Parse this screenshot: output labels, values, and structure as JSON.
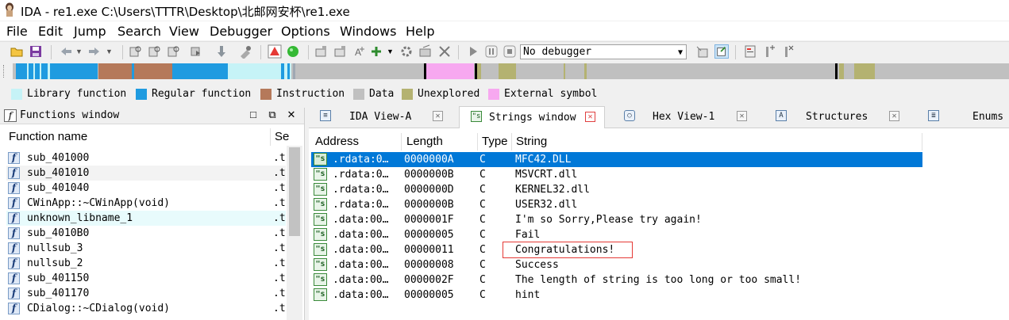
{
  "window": {
    "title": "IDA - re1.exe C:\\Users\\TTTR\\Desktop\\北邮网安杯\\re1.exe"
  },
  "menu": [
    "File",
    "Edit",
    "Jump",
    "Search",
    "View",
    "Debugger",
    "Options",
    "Windows",
    "Help"
  ],
  "toolbar": {
    "debugger_select": "No debugger"
  },
  "legend": [
    {
      "label": "Library function",
      "color": "#c6f3f7"
    },
    {
      "label": "Regular function",
      "color": "#1f9be0"
    },
    {
      "label": "Instruction",
      "color": "#b5795a"
    },
    {
      "label": "Data",
      "color": "#c0c0c0"
    },
    {
      "label": "Unexplored",
      "color": "#b4b271"
    },
    {
      "label": "External symbol",
      "color": "#f7a8f0"
    }
  ],
  "functions_window": {
    "title": "Functions window",
    "col_name": "Function name",
    "col_segment": "Se",
    "rows": [
      {
        "name": "sub_401000",
        "seg": ".t"
      },
      {
        "name": "sub_401010",
        "seg": ".t"
      },
      {
        "name": "sub_401040",
        "seg": ".t"
      },
      {
        "name": "CWinApp::~CWinApp(void)",
        "seg": ".t"
      },
      {
        "name": "unknown_libname_1",
        "seg": ".t"
      },
      {
        "name": "sub_4010B0",
        "seg": ".t"
      },
      {
        "name": "nullsub_3",
        "seg": ".t"
      },
      {
        "name": "nullsub_2",
        "seg": ".t"
      },
      {
        "name": "sub_401150",
        "seg": ".t"
      },
      {
        "name": "sub_401170",
        "seg": ".t"
      },
      {
        "name": "CDialog::~CDialog(void)",
        "seg": ".t"
      }
    ]
  },
  "tabs": [
    {
      "label": "IDA View-A"
    },
    {
      "label": "Strings window"
    },
    {
      "label": "Hex View-1"
    },
    {
      "label": "Structures"
    },
    {
      "label": "Enums"
    }
  ],
  "strings_window": {
    "columns": [
      "Address",
      "Length",
      "Type",
      "String"
    ],
    "rows": [
      {
        "address": ".rdata:0…",
        "length": "0000000A",
        "type": "C",
        "string": "MFC42.DLL"
      },
      {
        "address": ".rdata:0…",
        "length": "0000000B",
        "type": "C",
        "string": "MSVCRT.dll"
      },
      {
        "address": ".rdata:0…",
        "length": "0000000D",
        "type": "C",
        "string": "KERNEL32.dll"
      },
      {
        "address": ".rdata:0…",
        "length": "0000000B",
        "type": "C",
        "string": "USER32.dll"
      },
      {
        "address": ".data:00…",
        "length": "0000001F",
        "type": "C",
        "string": "I'm so Sorry,Please try again!"
      },
      {
        "address": ".data:00…",
        "length": "00000005",
        "type": "C",
        "string": "Fail"
      },
      {
        "address": ".data:00…",
        "length": "00000011",
        "type": "C",
        "string": "Congratulations!"
      },
      {
        "address": ".data:00…",
        "length": "00000008",
        "type": "C",
        "string": "Success"
      },
      {
        "address": ".data:00…",
        "length": "0000002F",
        "type": "C",
        "string": "The length of string is too long or too small!"
      },
      {
        "address": ".data:00…",
        "length": "00000005",
        "type": "C",
        "string": "hint"
      }
    ]
  }
}
